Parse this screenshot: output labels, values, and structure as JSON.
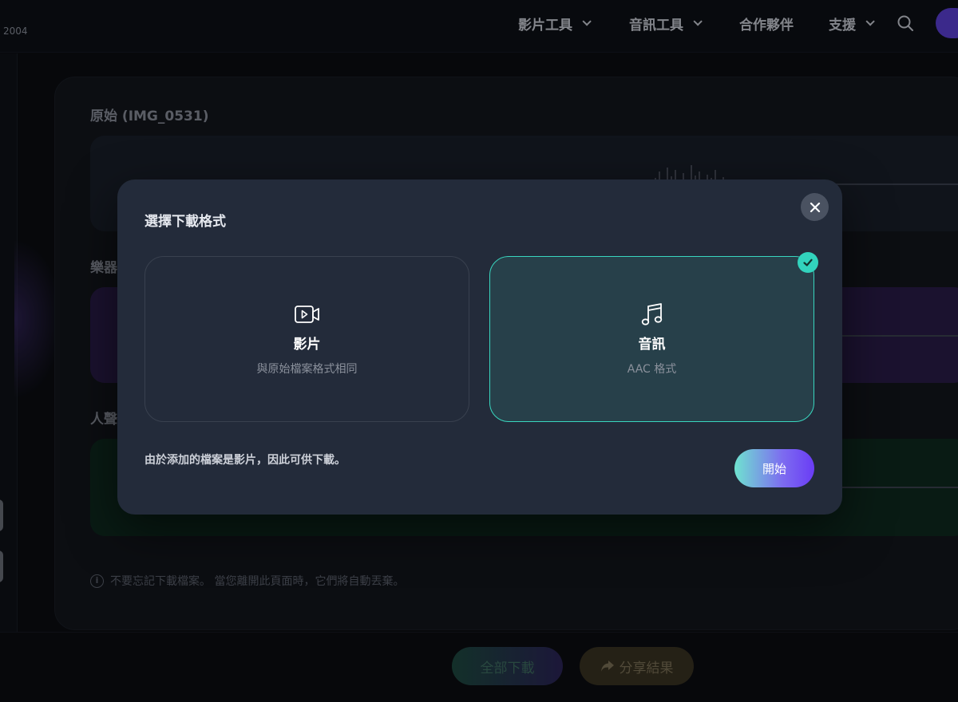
{
  "header": {
    "year_text": "2004",
    "nav": [
      {
        "label": "影片工具",
        "has_dropdown": true
      },
      {
        "label": "音訊工具",
        "has_dropdown": true
      },
      {
        "label": "合作夥伴",
        "has_dropdown": false
      },
      {
        "label": "支援",
        "has_dropdown": true
      }
    ]
  },
  "page": {
    "original_title": "原始 (IMG_0531)",
    "instrument_title": "樂器",
    "vocal_title": "人聲",
    "notice": "不要忘記下載檔案。 當您離開此頁面時，它們將自動丟棄。",
    "download_all_label": "全部下載",
    "share_label": "分享結果"
  },
  "modal": {
    "title": "選擇下載格式",
    "options": [
      {
        "icon": "video-icon",
        "label": "影片",
        "sub": "與原始檔案格式相同",
        "selected": false
      },
      {
        "icon": "music-note-icon",
        "label": "音訊",
        "sub": "AAC 格式",
        "selected": true
      }
    ],
    "footnote": "由於添加的檔案是影片，因此可供下載。",
    "start_label": "開始"
  },
  "colors": {
    "selected_border": "#39d6bf",
    "check_badge": "#32d3bd",
    "modal_bg": "#232b3a",
    "instrument_track": "#2a1d49",
    "vocal_track": "#0f2a1f"
  }
}
